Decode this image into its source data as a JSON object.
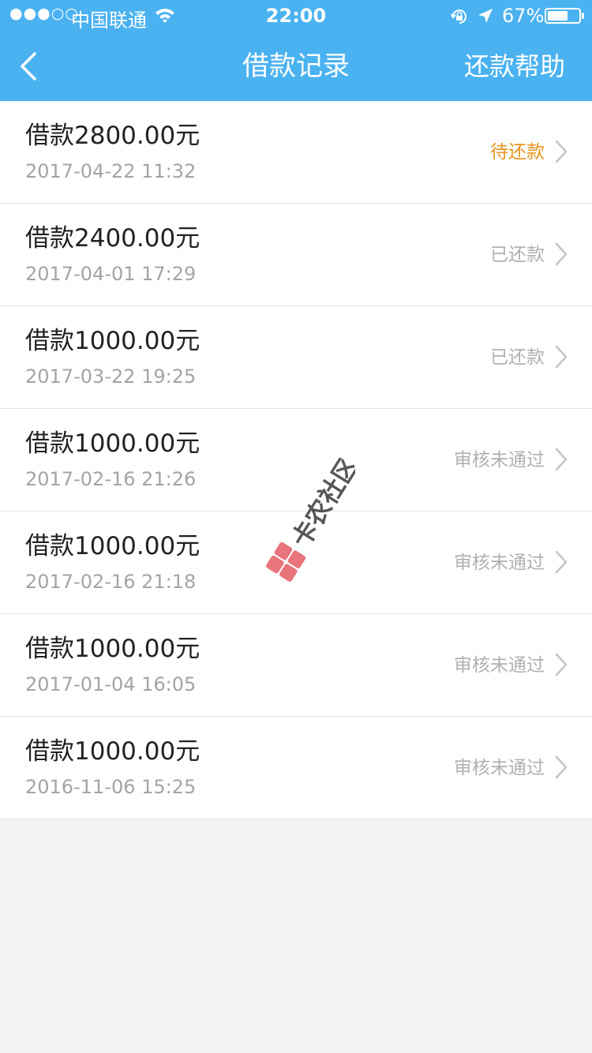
{
  "status_bar": {
    "signal": "●●●○○",
    "carrier": "中国联通",
    "time": "22:00",
    "battery_percent": "67%",
    "battery_level": 0.67
  },
  "nav": {
    "title": "借款记录",
    "right_button": "还款帮助",
    "back_icon": "chevron-left-icon"
  },
  "records": [
    {
      "amount": "借款2800.00元",
      "date": "2017-04-22 11:32",
      "status": "待还款",
      "status_color": "#e8941f"
    },
    {
      "amount": "借款2400.00元",
      "date": "2017-04-01 17:29",
      "status": "已还款",
      "status_color": "#b0b0b0"
    },
    {
      "amount": "借款1000.00元",
      "date": "2017-03-22 19:25",
      "status": "已还款",
      "status_color": "#b0b0b0"
    },
    {
      "amount": "借款1000.00元",
      "date": "2017-02-16 21:26",
      "status": "审核未通过",
      "status_color": "#b0b0b0"
    },
    {
      "amount": "借款1000.00元",
      "date": "2017-02-16 21:18",
      "status": "审核未通过",
      "status_color": "#b0b0b0"
    },
    {
      "amount": "借款1000.00元",
      "date": "2017-01-04 16:05",
      "status": "审核未通过",
      "status_color": "#b0b0b0"
    },
    {
      "amount": "借款1000.00元",
      "date": "2016-11-06 15:25",
      "status": "审核未通过",
      "status_color": "#b0b0b0"
    }
  ],
  "watermark": {
    "text": "卡农社区",
    "icon": "kanong-logo-icon"
  },
  "colors": {
    "header": "#4ab2f1",
    "pending": "#e8941f",
    "muted": "#b0b0b0",
    "background": "#f2f2f2"
  }
}
